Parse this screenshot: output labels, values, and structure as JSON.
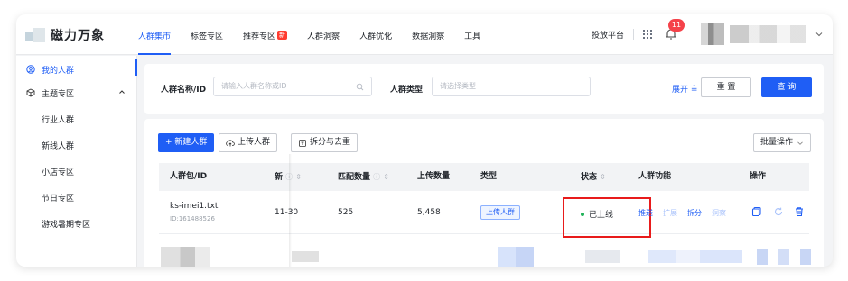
{
  "header": {
    "logo_text": "磁力万象",
    "nav": [
      "人群集市",
      "标签专区",
      "推荐专区",
      "人群洞察",
      "人群优化",
      "数据洞察",
      "工具"
    ],
    "nav_hot_badge": "新",
    "launch_platform": "投放平台",
    "notification_count": "11"
  },
  "sidebar": {
    "my_audience": "我的人群",
    "topic_zone": "主题专区",
    "sub_items": [
      "行业人群",
      "新线人群",
      "小店专区",
      "节日专区",
      "游戏暑期专区"
    ]
  },
  "filter": {
    "name_label": "人群名称/ID",
    "name_placeholder": "请输入人群名称或ID",
    "type_label": "人群类型",
    "type_placeholder": "请选择类型",
    "expand": "展开",
    "reset": "重 置",
    "query": "查 询"
  },
  "toolbar": {
    "new_audience": "+ 新建人群",
    "upload": "上传人群",
    "split_dedupe": "拆分与去重",
    "batch": "批量操作"
  },
  "table": {
    "headers": [
      "人群包/ID",
      "新",
      "匹配数量",
      "上传数量",
      "类型",
      "状态",
      "人群功能",
      "操作"
    ],
    "row": {
      "name": "ks-imei1.txt",
      "id": "ID:161488526",
      "updated": "11-30",
      "matched": "525",
      "uploaded": "5,458",
      "type": "上传人群",
      "status": "已上线",
      "functions": [
        "推送",
        "扩展",
        "拆分",
        "洞察"
      ]
    }
  },
  "colors": {
    "primary": "#1f5ef5",
    "highlight_box": "#e81b1b",
    "status_online": "#21b35a",
    "badge_red": "#f5424a"
  }
}
